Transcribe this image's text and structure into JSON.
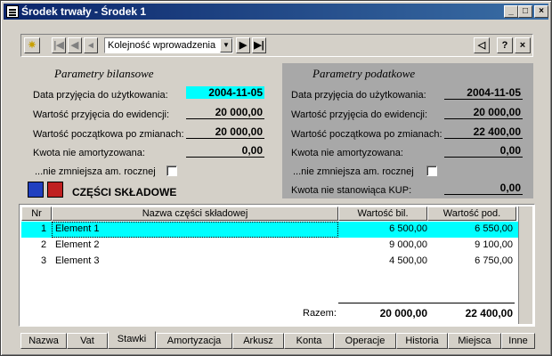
{
  "window": {
    "title": "Środek trwały - Środek 1"
  },
  "toolbar": {
    "order_combo": "Kolejność wprowadzenia"
  },
  "bilans": {
    "title": "Parametry bilansowe",
    "labels": [
      "Data przyjęcia do użytkowania:",
      "Wartość przyjęcia do ewidencji:",
      "Wartość początkowa po zmianach:",
      "Kwota nie amortyzowana:",
      "...nie zmniejsza am. rocznej"
    ],
    "values": [
      "2004-11-05",
      "20 000,00",
      "20 000,00",
      "0,00"
    ]
  },
  "podatek": {
    "title": "Parametry podatkowe",
    "labels": [
      "Data przyjęcia do użytkowania:",
      "Wartość przyjęcia do ewidencji:",
      "Wartość początkowa po zmianach:",
      "Kwota nie amortyzowana:",
      "...nie zmniejsza am. rocznej",
      "Kwota nie stanowiąca KUP:"
    ],
    "values": [
      "2004-11-05",
      "20 000,00",
      "22 400,00",
      "0,00",
      "0,00"
    ]
  },
  "parts": {
    "title": "CZĘŚCI SKŁADOWE",
    "headers": [
      "Nr",
      "Nazwa części składowej",
      "Wartość bil.",
      "Wartość pod."
    ],
    "rows": [
      {
        "nr": "1",
        "name": "Element 1",
        "bil": "6 500,00",
        "pod": "6 550,00"
      },
      {
        "nr": "2",
        "name": "Element 2",
        "bil": "9 000,00",
        "pod": "9 100,00"
      },
      {
        "nr": "3",
        "name": "Element 3",
        "bil": "4 500,00",
        "pod": "6 750,00"
      }
    ],
    "total_label": "Razem:",
    "total_bil": "20 000,00",
    "total_pod": "22 400,00"
  },
  "tabs": [
    "Nazwa",
    "Vat",
    "Stawki",
    "Amortyzacja",
    "Arkusz",
    "Konta",
    "Operacje",
    "Historia",
    "Miejsca",
    "Inne"
  ],
  "colors": {
    "highlight": "#00ffff",
    "titlebar": "#0a246a",
    "panel_right": "#a8a8a8"
  }
}
